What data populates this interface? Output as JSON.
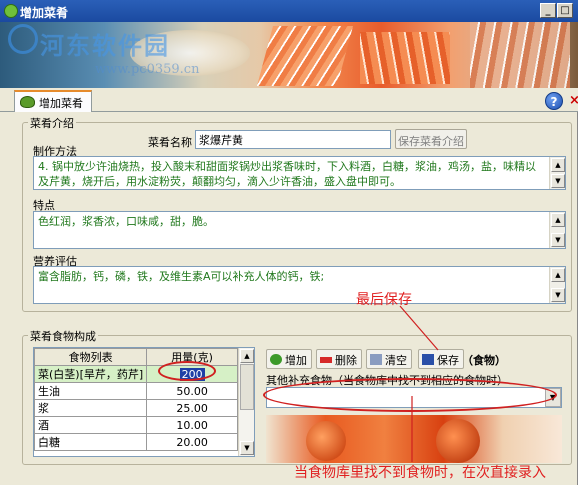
{
  "window": {
    "title": "增加菜肴",
    "min_label": "_",
    "max_label": "□"
  },
  "banner": {
    "watermark_cn": "河东软件园",
    "watermark_url": "www.pc0359.cn"
  },
  "tab": {
    "label": "增加菜肴"
  },
  "toolbar": {
    "help_label": "?",
    "close_label": "×"
  },
  "intro": {
    "group_title": "菜肴介绍",
    "dish_name_label": "菜肴名称",
    "dish_name_value": "浆爆芹黄",
    "save_intro_label": "保存菜肴介绍",
    "method_label": "制作方法",
    "method_text": "4. 锅中放少许油烧热，投入酸末和甜面浆锅炒出浆香味时，下入料酒，白糖，浆油，鸡汤，盐，味精以及芹黄，烧开后，用水淀粉荧，颠翻均匀，滴入少许香油，盛入盘中即可。",
    "feature_label": "特点",
    "feature_text": "色红润，浆香浓，口味咸，甜，脆。",
    "nutrition_label": "营养评估",
    "nutrition_text": "富含脂肪，钙，磷，铁，及维生素A可以补充人体的钙，铁;"
  },
  "composition": {
    "group_title": "菜肴食物构成",
    "columns": [
      "食物列表",
      "用量(克)"
    ],
    "rows": [
      {
        "food": "菜(白茎)[旱芹，药芹]",
        "amount": "200"
      },
      {
        "food": "生油",
        "amount": "50.00"
      },
      {
        "food": "浆",
        "amount": "25.00"
      },
      {
        "food": "酒",
        "amount": "10.00"
      },
      {
        "food": "白糖",
        "amount": "20.00"
      }
    ],
    "buttons": {
      "add": "增加",
      "delete": "删除",
      "clear": "清空",
      "save": "保存"
    },
    "food_suffix": "（食物）",
    "other_label": "其他补充食物（当食物库中找不到相应的食物时）",
    "other_value": ""
  },
  "annotations": {
    "last_save": "最后保存",
    "direct_entry": "当食物库里找不到食物时，在次直接录入"
  },
  "colors": {
    "annotation": "#e02020",
    "memo_text": "#20781c",
    "title_bar": "#1b4aa0"
  }
}
